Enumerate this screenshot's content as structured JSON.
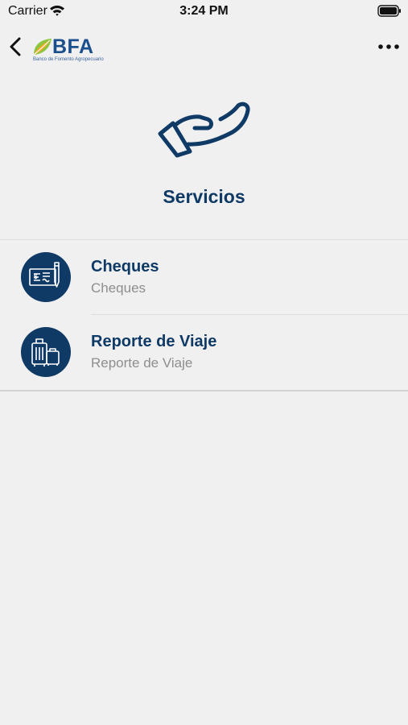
{
  "status": {
    "carrier": "Carrier",
    "time": "3:24 PM"
  },
  "nav": {
    "logo_text": "BFA",
    "logo_subtitle": "Banco de Fomento Agropecuario"
  },
  "page": {
    "title": "Servicios"
  },
  "services": [
    {
      "title": "Cheques",
      "subtitle": "Cheques",
      "icon": "check-icon"
    },
    {
      "title": "Reporte de Viaje",
      "subtitle": "Reporte de Viaje",
      "icon": "luggage-icon"
    }
  ],
  "colors": {
    "primary": "#0f3a66",
    "background": "#f0f0f0",
    "subtitle": "#8e8e8e"
  }
}
